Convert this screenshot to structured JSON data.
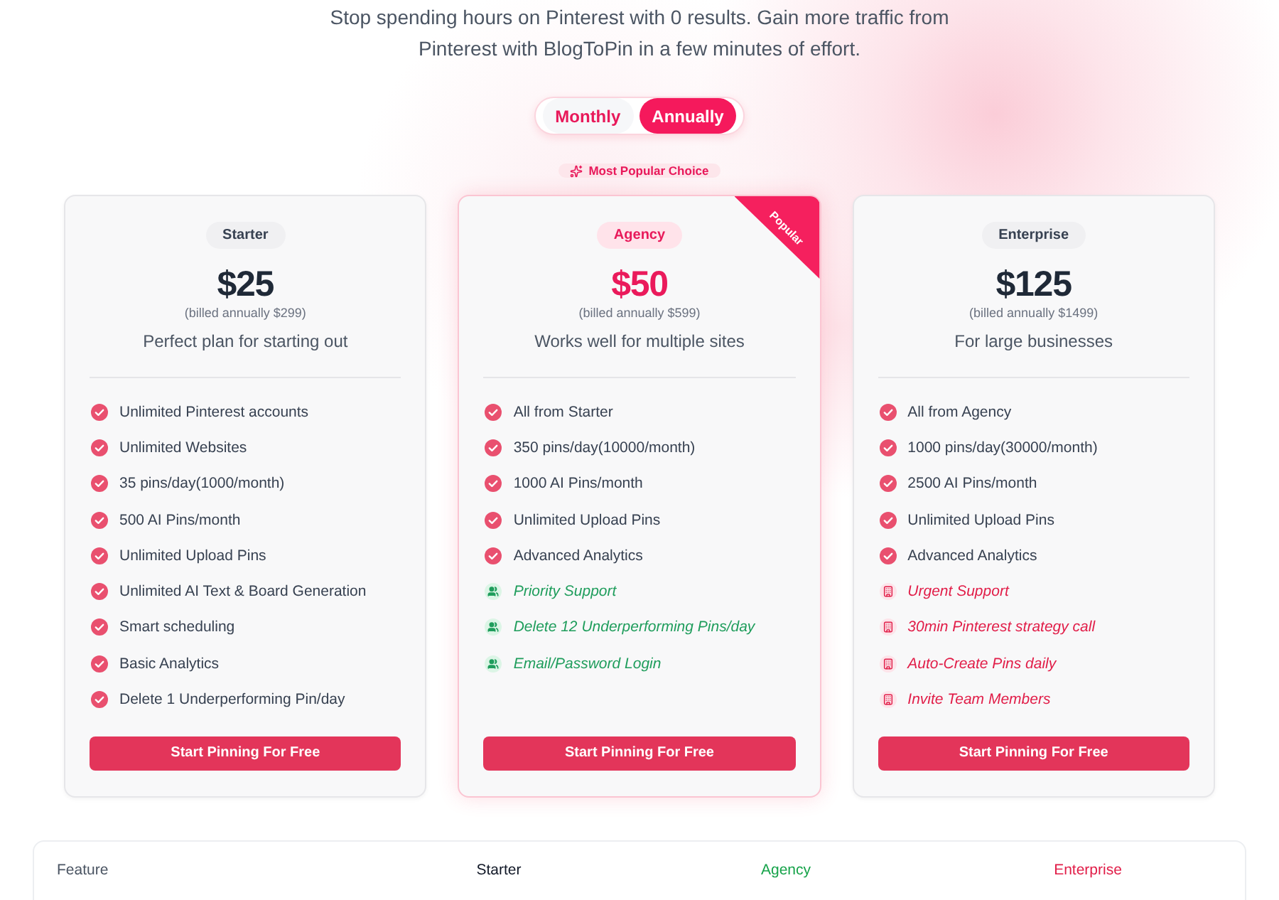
{
  "subtitle": "Stop spending hours on Pinterest with 0 results. Gain more traffic from Pinterest with BlogToPin in a few minutes of effort.",
  "billing_toggle": [
    {
      "label": "Monthly",
      "selected": false
    },
    {
      "label": "Annually",
      "selected": true
    }
  ],
  "popular_badge": "Most Popular Choice",
  "plans": [
    {
      "name": "Starter",
      "featured": false,
      "price": "$25",
      "billed": "(billed annually $299)",
      "description": "Perfect plan for starting out",
      "features": [
        {
          "text": "Unlimited Pinterest accounts",
          "kind": "standard"
        },
        {
          "text": "Unlimited Websites",
          "kind": "standard"
        },
        {
          "text": "35 pins/day(1000/month)",
          "kind": "standard"
        },
        {
          "text": "500 AI Pins/month",
          "kind": "standard"
        },
        {
          "text": "Unlimited Upload Pins",
          "kind": "standard"
        },
        {
          "text": "Unlimited AI Text & Board Generation",
          "kind": "standard"
        },
        {
          "text": "Smart scheduling",
          "kind": "standard"
        },
        {
          "text": "Basic Analytics",
          "kind": "standard"
        },
        {
          "text": "Delete 1 Underperforming Pin/day",
          "kind": "standard"
        }
      ],
      "button": "Start Pinning For Free"
    },
    {
      "name": "Agency",
      "featured": true,
      "ribbon": "Popular",
      "price": "$50",
      "billed": "(billed annually $599)",
      "description": "Works well for multiple sites",
      "features": [
        {
          "text": "All from Starter",
          "kind": "standard"
        },
        {
          "text": "350 pins/day(10000/month)",
          "kind": "standard"
        },
        {
          "text": "1000 AI Pins/month",
          "kind": "standard"
        },
        {
          "text": "Unlimited Upload Pins",
          "kind": "standard"
        },
        {
          "text": "Advanced Analytics",
          "kind": "standard"
        },
        {
          "text": "Priority Support",
          "kind": "plus"
        },
        {
          "text": "Delete 12 Underperforming Pins/day",
          "kind": "plus"
        },
        {
          "text": "Email/Password Login",
          "kind": "plus"
        }
      ],
      "button": "Start Pinning For Free"
    },
    {
      "name": "Enterprise",
      "featured": false,
      "price": "$125",
      "billed": "(billed annually $1499)",
      "description": "For large businesses",
      "features": [
        {
          "text": "All from Agency",
          "kind": "standard"
        },
        {
          "text": "1000 pins/day(30000/month)",
          "kind": "standard"
        },
        {
          "text": "2500 AI Pins/month",
          "kind": "standard"
        },
        {
          "text": "Unlimited Upload Pins",
          "kind": "standard"
        },
        {
          "text": "Advanced Analytics",
          "kind": "standard"
        },
        {
          "text": "Urgent Support",
          "kind": "premium"
        },
        {
          "text": "30min Pinterest strategy call",
          "kind": "premium"
        },
        {
          "text": "Auto-Create Pins daily",
          "kind": "premium"
        },
        {
          "text": "Invite Team Members",
          "kind": "premium"
        }
      ],
      "button": "Start Pinning For Free"
    }
  ],
  "comparison_table": {
    "columns": [
      {
        "label": "Feature",
        "color": "#4b5563"
      },
      {
        "label": "Starter",
        "color": "#111827"
      },
      {
        "label": "Agency",
        "color": "#16a34a"
      },
      {
        "label": "Enterprise",
        "color": "#e11d48"
      }
    ]
  }
}
